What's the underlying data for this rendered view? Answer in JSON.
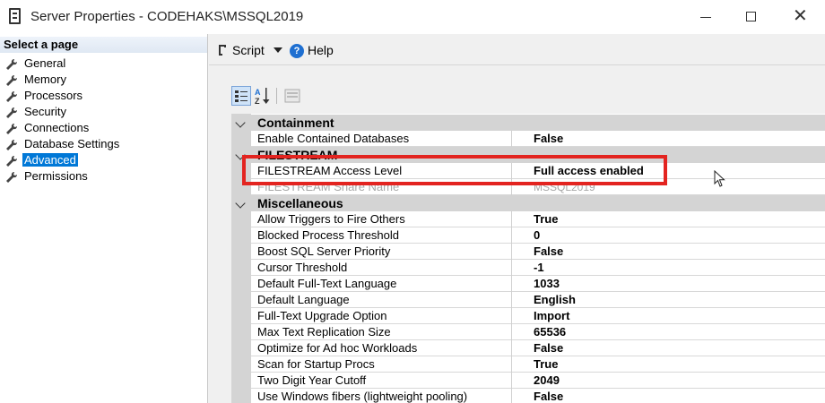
{
  "window": {
    "title": "Server Properties - CODEHAKS\\MSSQL2019"
  },
  "left_panel": {
    "header": "Select a page",
    "pages": [
      {
        "label": "General"
      },
      {
        "label": "Memory"
      },
      {
        "label": "Processors"
      },
      {
        "label": "Security"
      },
      {
        "label": "Connections"
      },
      {
        "label": "Database Settings"
      },
      {
        "label": "Advanced",
        "selected": true
      },
      {
        "label": "Permissions"
      }
    ]
  },
  "toolbar": {
    "script_label": "Script",
    "help_label": "Help"
  },
  "property_grid": {
    "categories": [
      {
        "label": "Containment",
        "properties": [
          {
            "name": "Enable Contained Databases",
            "value": "False"
          }
        ]
      },
      {
        "label": "FILESTREAM",
        "properties": [
          {
            "name": "FILESTREAM Access Level",
            "value": "Full access enabled"
          },
          {
            "name": "FILESTREAM Share Name",
            "value": "MSSQL2019"
          }
        ]
      },
      {
        "label": "Miscellaneous",
        "properties": [
          {
            "name": "Allow Triggers to Fire Others",
            "value": "True"
          },
          {
            "name": "Blocked Process Threshold",
            "value": "0"
          },
          {
            "name": "Boost SQL Server Priority",
            "value": "False"
          },
          {
            "name": "Cursor Threshold",
            "value": "-1"
          },
          {
            "name": "Default Full-Text Language",
            "value": "1033"
          },
          {
            "name": "Default Language",
            "value": "English"
          },
          {
            "name": "Full-Text Upgrade Option",
            "value": "Import"
          },
          {
            "name": "Max Text Replication Size",
            "value": "65536"
          },
          {
            "name": "Optimize for Ad hoc Workloads",
            "value": "False"
          },
          {
            "name": "Scan for Startup Procs",
            "value": "True"
          },
          {
            "name": "Two Digit Year Cutoff",
            "value": "2049"
          },
          {
            "name": "Use Windows fibers (lightweight pooling)",
            "value": "False"
          }
        ]
      }
    ]
  },
  "colors": {
    "selection": "#0078d7",
    "highlight_box": "#e32420",
    "category_bg": "#d4d4d4"
  }
}
